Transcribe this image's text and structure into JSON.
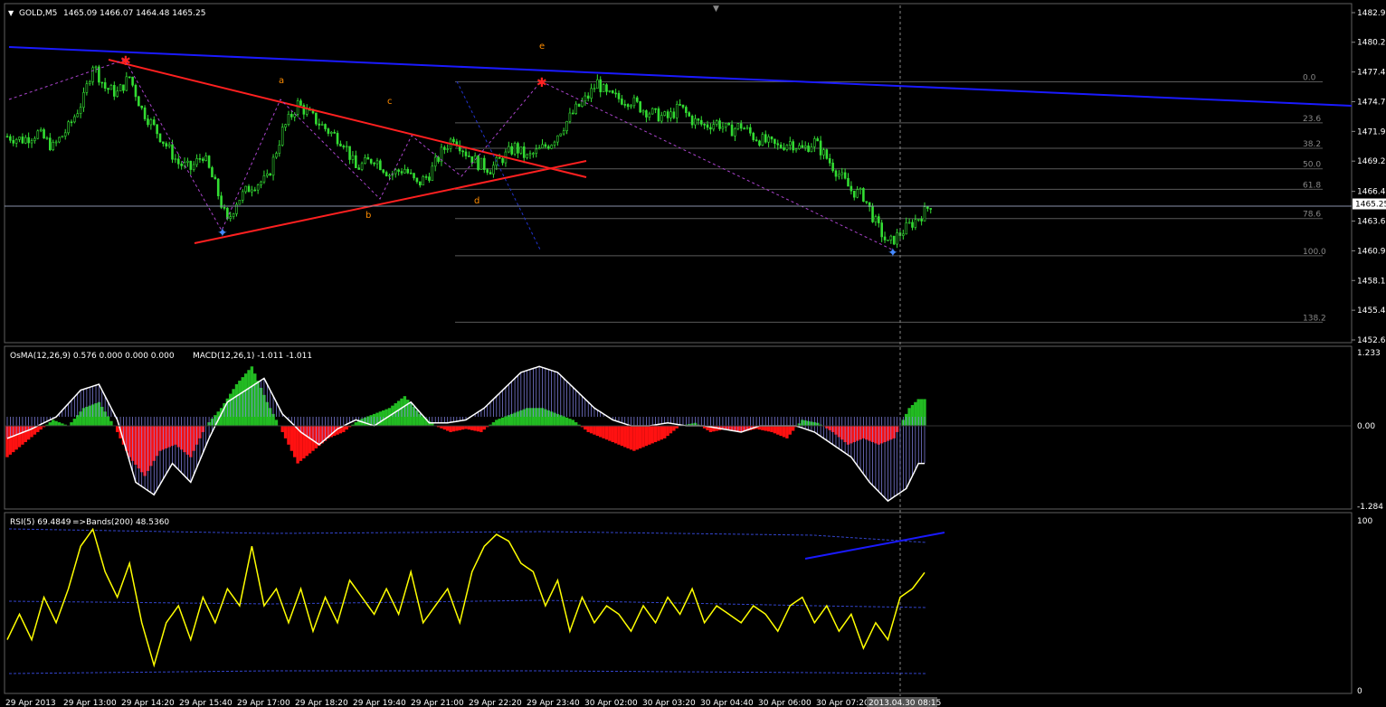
{
  "header": {
    "symbol": "GOLD,M5",
    "ohlc": "1465.09 1466.07 1464.48 1465.25",
    "osma_label": "OsMA(12,26,9) 0.576 0.000 0.000 0.000",
    "macd_label": "MACD(12,26,1) -1.011 -1.011",
    "rsi_label": "RSI(5) 69.4849",
    "bands_label": "=>Bands(200) 48.5360"
  },
  "price_axis": {
    "ticks": [
      "1482.95",
      "1480.21",
      "1477.46",
      "1474.71",
      "1471.96",
      "1469.21",
      "1466.41",
      "1463.66",
      "1460.91",
      "1458.16",
      "1455.41",
      "1452.66"
    ],
    "current": "1465.25"
  },
  "osc_axis": {
    "ticks": [
      "1.233",
      "0.00",
      "-1.284"
    ]
  },
  "rsi_axis": {
    "ticks": [
      "100",
      "0"
    ]
  },
  "fib_levels": [
    "0.0",
    "23.6",
    "38.2",
    "50.0",
    "61.8",
    "78.6",
    "100.0",
    "138.2"
  ],
  "wave_labels": [
    "a",
    "b",
    "c",
    "d",
    "e"
  ],
  "time_axis": [
    "29 Apr 2013",
    "29 Apr 13:00",
    "29 Apr 14:20",
    "29 Apr 15:40",
    "29 Apr 17:00",
    "29 Apr 18:20",
    "29 Apr 19:40",
    "29 Apr 21:00",
    "29 Apr 22:20",
    "29 Apr 23:40",
    "30 Apr 02:00",
    "30 Apr 03:20",
    "30 Apr 04:40",
    "30 Apr 06:00",
    "30 Apr 07:20",
    "2013.04.30 08:15"
  ],
  "colors": {
    "bull": "#33dd33",
    "bear": "#ff2222",
    "trendline_blue": "#1a1aff",
    "triangle_red": "#ff2020",
    "rsi": "#ffff00",
    "macd": "#ffffff",
    "grid": "#606060"
  },
  "chart_data": [
    {
      "type": "candlestick",
      "title": "GOLD,M5",
      "ylim": [
        1452.66,
        1482.95
      ],
      "close_path": [
        [
          0,
          1471.5
        ],
        [
          5,
          1471.2
        ],
        [
          10,
          1471.8
        ],
        [
          15,
          1470.5
        ],
        [
          20,
          1472.3
        ],
        [
          25,
          1475.0
        ],
        [
          28,
          1478.2
        ],
        [
          32,
          1476.0
        ],
        [
          36,
          1475.5
        ],
        [
          40,
          1477.0
        ],
        [
          44,
          1474.0
        ],
        [
          50,
          1471.5
        ],
        [
          56,
          1469.0
        ],
        [
          60,
          1468.5
        ],
        [
          64,
          1469.8
        ],
        [
          68,
          1467.0
        ],
        [
          72,
          1463.5
        ],
        [
          75,
          1465.5
        ],
        [
          80,
          1467.0
        ],
        [
          85,
          1467.5
        ],
        [
          90,
          1472.0
        ],
        [
          95,
          1474.5
        ],
        [
          100,
          1473.2
        ],
        [
          105,
          1472.0
        ],
        [
          110,
          1471.0
        ],
        [
          114,
          1468.5
        ],
        [
          120,
          1469.5
        ],
        [
          125,
          1468.0
        ],
        [
          130,
          1468.5
        ],
        [
          134,
          1467.0
        ],
        [
          138,
          1468.0
        ],
        [
          142,
          1470.0
        ],
        [
          146,
          1471.5
        ],
        [
          150,
          1470.0
        ],
        [
          154,
          1469.0
        ],
        [
          158,
          1468.5
        ],
        [
          162,
          1469.5
        ],
        [
          166,
          1470.5
        ],
        [
          170,
          1469.5
        ],
        [
          174,
          1470.2
        ],
        [
          178,
          1471.0
        ],
        [
          182,
          1472.5
        ],
        [
          186,
          1474.0
        ],
        [
          190,
          1475.2
        ],
        [
          193,
          1476.5
        ],
        [
          196,
          1475.3
        ],
        [
          200,
          1475.0
        ],
        [
          204,
          1474.8
        ],
        [
          208,
          1474.0
        ],
        [
          212,
          1473.5
        ],
        [
          216,
          1473.2
        ],
        [
          220,
          1474.2
        ],
        [
          224,
          1473.0
        ],
        [
          228,
          1472.5
        ],
        [
          232,
          1472.8
        ],
        [
          236,
          1472.0
        ],
        [
          240,
          1472.5
        ],
        [
          244,
          1471.5
        ],
        [
          248,
          1471.0
        ],
        [
          252,
          1470.5
        ],
        [
          256,
          1471.0
        ],
        [
          260,
          1470.3
        ],
        [
          264,
          1471.0
        ],
        [
          268,
          1469.5
        ],
        [
          272,
          1468.0
        ],
        [
          276,
          1466.5
        ],
        [
          280,
          1466.0
        ],
        [
          284,
          1463.5
        ],
        [
          288,
          1461.5
        ],
        [
          292,
          1462.5
        ],
        [
          296,
          1463.5
        ],
        [
          300,
          1464.5
        ],
        [
          302,
          1465.25
        ]
      ]
    },
    {
      "type": "bar",
      "title": "OsMA(12,26,9)",
      "ylim": [
        -1.284,
        1.233
      ],
      "series": [
        {
          "name": "OsMA",
          "values": [
            [
              0,
              -0.5
            ],
            [
              5,
              -0.3
            ],
            [
              10,
              -0.1
            ],
            [
              15,
              0.1
            ],
            [
              20,
              0.0
            ],
            [
              25,
              0.3
            ],
            [
              30,
              0.4
            ],
            [
              35,
              0.0
            ],
            [
              40,
              -0.5
            ],
            [
              45,
              -0.8
            ],
            [
              50,
              -0.4
            ],
            [
              55,
              -0.3
            ],
            [
              60,
              -0.5
            ],
            [
              65,
              0.0
            ],
            [
              70,
              0.3
            ],
            [
              75,
              0.7
            ],
            [
              80,
              1.0
            ],
            [
              85,
              0.4
            ],
            [
              90,
              -0.1
            ],
            [
              95,
              -0.6
            ],
            [
              100,
              -0.4
            ],
            [
              105,
              -0.2
            ],
            [
              110,
              -0.1
            ],
            [
              115,
              0.1
            ],
            [
              120,
              0.2
            ],
            [
              125,
              0.3
            ],
            [
              130,
              0.5
            ],
            [
              135,
              0.2
            ],
            [
              140,
              0.0
            ],
            [
              145,
              -0.1
            ],
            [
              150,
              -0.05
            ],
            [
              155,
              -0.1
            ],
            [
              160,
              0.1
            ],
            [
              165,
              0.2
            ],
            [
              170,
              0.3
            ],
            [
              175,
              0.3
            ],
            [
              180,
              0.2
            ],
            [
              185,
              0.1
            ],
            [
              190,
              -0.1
            ],
            [
              195,
              -0.2
            ],
            [
              200,
              -0.3
            ],
            [
              205,
              -0.4
            ],
            [
              210,
              -0.3
            ],
            [
              215,
              -0.2
            ],
            [
              220,
              0.0
            ],
            [
              225,
              0.05
            ],
            [
              230,
              -0.1
            ],
            [
              235,
              -0.05
            ],
            [
              240,
              -0.1
            ],
            [
              245,
              -0.05
            ],
            [
              250,
              -0.1
            ],
            [
              255,
              -0.2
            ],
            [
              260,
              0.1
            ],
            [
              265,
              0.05
            ],
            [
              270,
              -0.1
            ],
            [
              275,
              -0.3
            ],
            [
              280,
              -0.2
            ],
            [
              285,
              -0.3
            ],
            [
              290,
              -0.2
            ],
            [
              295,
              0.3
            ],
            [
              298,
              0.45
            ]
          ]
        },
        {
          "name": "MACD",
          "values": [
            [
              0,
              -0.2
            ],
            [
              8,
              -0.05
            ],
            [
              16,
              0.15
            ],
            [
              24,
              0.6
            ],
            [
              30,
              0.7
            ],
            [
              36,
              0.1
            ],
            [
              42,
              -0.9
            ],
            [
              48,
              -1.1
            ],
            [
              54,
              -0.6
            ],
            [
              60,
              -0.9
            ],
            [
              66,
              -0.2
            ],
            [
              72,
              0.4
            ],
            [
              78,
              0.6
            ],
            [
              84,
              0.8
            ],
            [
              90,
              0.2
            ],
            [
              96,
              -0.1
            ],
            [
              102,
              -0.3
            ],
            [
              108,
              -0.05
            ],
            [
              114,
              0.1
            ],
            [
              120,
              0.0
            ],
            [
              126,
              0.2
            ],
            [
              132,
              0.4
            ],
            [
              138,
              0.05
            ],
            [
              144,
              0.05
            ],
            [
              150,
              0.1
            ],
            [
              156,
              0.3
            ],
            [
              162,
              0.6
            ],
            [
              168,
              0.9
            ],
            [
              174,
              1.0
            ],
            [
              180,
              0.9
            ],
            [
              186,
              0.6
            ],
            [
              192,
              0.3
            ],
            [
              198,
              0.1
            ],
            [
              204,
              0.0
            ],
            [
              210,
              0.0
            ],
            [
              216,
              0.05
            ],
            [
              222,
              0.0
            ],
            [
              228,
              0.0
            ],
            [
              234,
              -0.05
            ],
            [
              240,
              -0.1
            ],
            [
              246,
              0.0
            ],
            [
              252,
              0.0
            ],
            [
              258,
              0.0
            ],
            [
              264,
              -0.1
            ],
            [
              270,
              -0.3
            ],
            [
              276,
              -0.5
            ],
            [
              282,
              -0.9
            ],
            [
              288,
              -1.2
            ],
            [
              294,
              -1.0
            ],
            [
              298,
              -0.6
            ]
          ]
        }
      ]
    },
    {
      "type": "line",
      "title": "RSI(5)",
      "ylim": [
        0,
        100
      ],
      "series": [
        {
          "name": "RSI",
          "values": [
            [
              0,
              30
            ],
            [
              4,
              45
            ],
            [
              8,
              30
            ],
            [
              12,
              55
            ],
            [
              16,
              40
            ],
            [
              20,
              60
            ],
            [
              24,
              85
            ],
            [
              28,
              95
            ],
            [
              32,
              70
            ],
            [
              36,
              55
            ],
            [
              40,
              75
            ],
            [
              44,
              40
            ],
            [
              48,
              15
            ],
            [
              52,
              40
            ],
            [
              56,
              50
            ],
            [
              60,
              30
            ],
            [
              64,
              55
            ],
            [
              68,
              40
            ],
            [
              72,
              60
            ],
            [
              76,
              50
            ],
            [
              80,
              85
            ],
            [
              84,
              50
            ],
            [
              88,
              60
            ],
            [
              92,
              40
            ],
            [
              96,
              60
            ],
            [
              100,
              35
            ],
            [
              104,
              55
            ],
            [
              108,
              40
            ],
            [
              112,
              65
            ],
            [
              116,
              55
            ],
            [
              120,
              45
            ],
            [
              124,
              60
            ],
            [
              128,
              45
            ],
            [
              132,
              70
            ],
            [
              136,
              40
            ],
            [
              140,
              50
            ],
            [
              144,
              60
            ],
            [
              148,
              40
            ],
            [
              152,
              70
            ],
            [
              156,
              85
            ],
            [
              160,
              92
            ],
            [
              164,
              88
            ],
            [
              168,
              75
            ],
            [
              172,
              70
            ],
            [
              176,
              50
            ],
            [
              180,
              65
            ],
            [
              184,
              35
            ],
            [
              188,
              55
            ],
            [
              192,
              40
            ],
            [
              196,
              50
            ],
            [
              200,
              45
            ],
            [
              204,
              35
            ],
            [
              208,
              50
            ],
            [
              212,
              40
            ],
            [
              216,
              55
            ],
            [
              220,
              45
            ],
            [
              224,
              60
            ],
            [
              228,
              40
            ],
            [
              232,
              50
            ],
            [
              236,
              45
            ],
            [
              240,
              40
            ],
            [
              244,
              50
            ],
            [
              248,
              45
            ],
            [
              252,
              35
            ],
            [
              256,
              50
            ],
            [
              260,
              55
            ],
            [
              264,
              40
            ],
            [
              268,
              50
            ],
            [
              272,
              35
            ],
            [
              276,
              45
            ],
            [
              280,
              25
            ],
            [
              284,
              40
            ],
            [
              288,
              30
            ],
            [
              292,
              55
            ],
            [
              296,
              60
            ],
            [
              300,
              69.5
            ]
          ]
        }
      ]
    }
  ]
}
